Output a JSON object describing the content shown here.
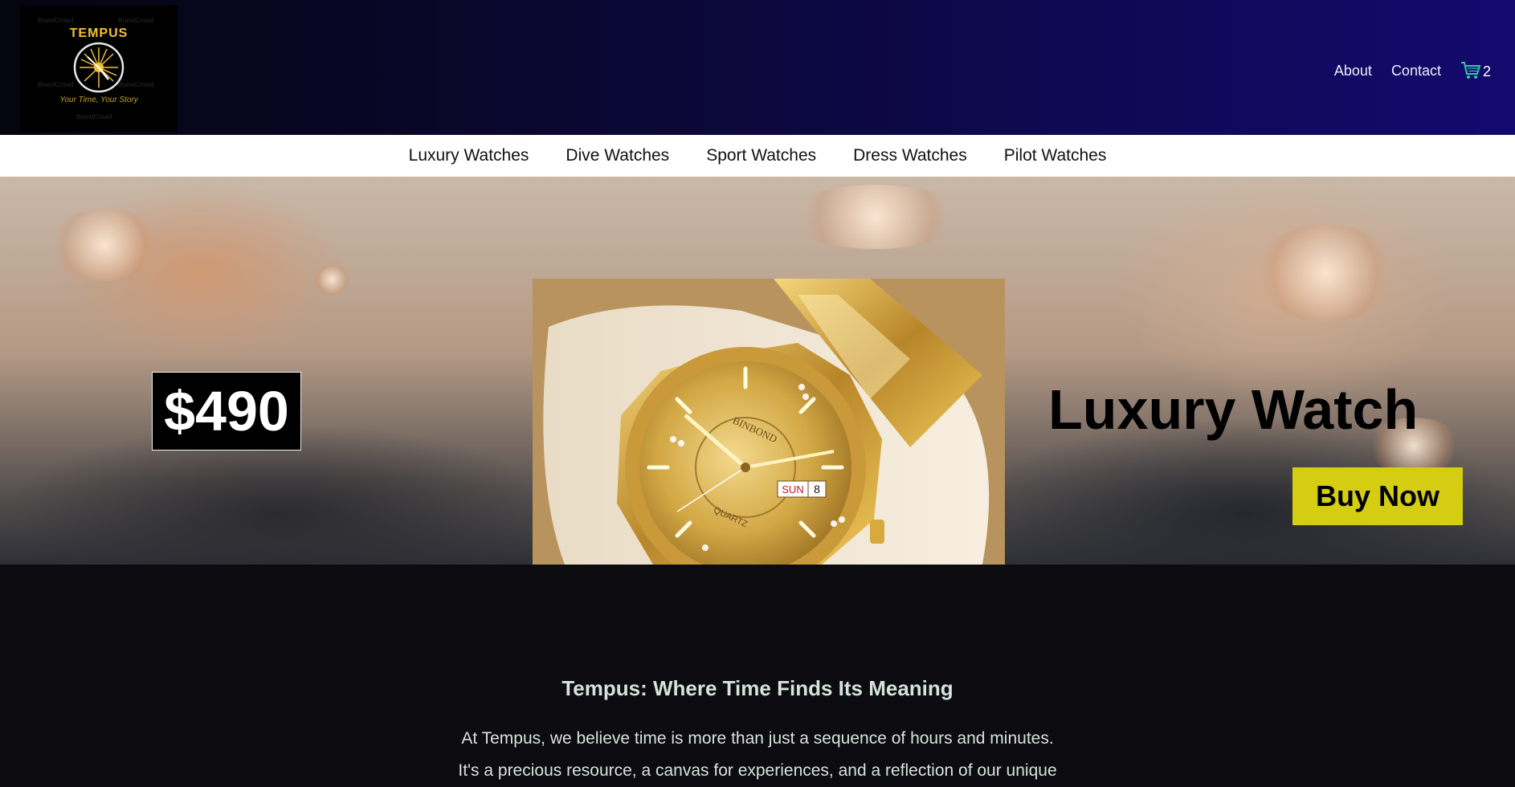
{
  "header": {
    "logo": {
      "title": "TEMPUS",
      "tagline": "Your Time, Your Story",
      "watermark": "BrandCrowd"
    },
    "nav": [
      {
        "label": "About"
      },
      {
        "label": "Contact"
      }
    ],
    "cart": {
      "icon": "cart-icon",
      "count": "2",
      "color": "#33c9a3"
    }
  },
  "categories": [
    {
      "label": "Luxury Watches"
    },
    {
      "label": "Dive Watches"
    },
    {
      "label": "Sport Watches"
    },
    {
      "label": "Dress Watches"
    },
    {
      "label": "Pilot Watches"
    }
  ],
  "hero": {
    "price": "$490",
    "title": "Luxury Watch",
    "cta": "Buy Now",
    "cta_color": "#d4cd12",
    "watch": {
      "brand": "BINBOND",
      "movement": "QUARTZ",
      "day": "SUN",
      "date": "8"
    }
  },
  "about": {
    "title": "Tempus: Where Time Finds Its Meaning",
    "text_line1": "At Tempus, we believe time is more than just a sequence of hours and minutes.",
    "text_line2": "It's a precious resource, a canvas for experiences, and a reflection of our unique"
  }
}
